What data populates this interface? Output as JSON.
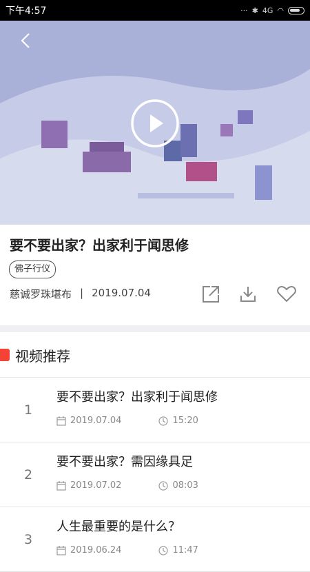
{
  "status_bar": {
    "time": "下午4:57",
    "network": "4G"
  },
  "video": {
    "play_label": "播放"
  },
  "detail": {
    "title": "要不要出家？出家利于闻思修",
    "tag": "佛子行仪",
    "author": "慈诚罗珠堪布",
    "separator": "|",
    "date": "2019.07.04"
  },
  "section": {
    "title": "视频推荐"
  },
  "list": [
    {
      "index": "1",
      "title": "要不要出家？出家利于闻思修",
      "date": "2019.07.04",
      "duration": "15:20"
    },
    {
      "index": "2",
      "title": "要不要出家？需因缘具足",
      "date": "2019.07.02",
      "duration": "08:03"
    },
    {
      "index": "3",
      "title": "人生最重要的是什么？",
      "date": "2019.06.24",
      "duration": "11:47"
    }
  ],
  "colors": {
    "accent": "#f44336"
  }
}
